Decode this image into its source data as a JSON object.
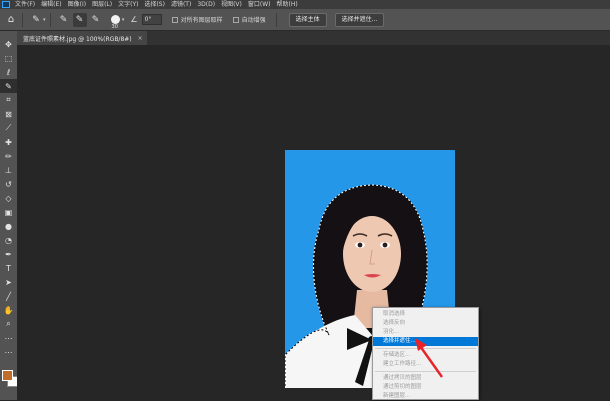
{
  "menubar": {
    "items": [
      "文件(F)",
      "编辑(E)",
      "图像(I)",
      "图层(L)",
      "文字(Y)",
      "选择(S)",
      "滤镜(T)",
      "3D(D)",
      "视图(V)",
      "窗口(W)",
      "帮助(H)"
    ]
  },
  "options": {
    "brush_size": "30",
    "angle": "0°",
    "sample_all_layers": "对所有图层取样",
    "auto_enhance": "自动增强",
    "select_subject": "选择主体",
    "select_and_mask": "选择并遮住..."
  },
  "document": {
    "tab_title": "蓝底证件照素材.jpg @ 100%(RGB/8#)",
    "close_glyph": "×"
  },
  "colors": {
    "foreground": "#c06c2b",
    "background": "#ffffff",
    "canvas_blue": "#2597e9",
    "menu_highlight": "#0078d7",
    "arrow_red": "#e8232a"
  },
  "context_menu": {
    "items": [
      {
        "label": "取消选择",
        "enabled": false
      },
      {
        "label": "选择反向",
        "enabled": false
      },
      {
        "label": "羽化...",
        "enabled": false
      },
      {
        "label": "选择并遮住...",
        "enabled": true,
        "highlighted": true
      },
      {
        "divider": true
      },
      {
        "label": "存储选区...",
        "enabled": false
      },
      {
        "label": "建立工作路径...",
        "enabled": false
      },
      {
        "divider": true
      },
      {
        "label": "通过拷贝的图层",
        "enabled": false
      },
      {
        "label": "通过剪切的图层",
        "enabled": false
      },
      {
        "label": "新建图层...",
        "enabled": false
      }
    ]
  },
  "toolbar": {
    "tools": [
      "move-tool",
      "marquee-tool",
      "lasso-tool",
      "quick-selection-tool",
      "crop-tool",
      "frame-tool",
      "eyedropper-tool",
      "healing-brush-tool",
      "brush-tool",
      "clone-stamp-tool",
      "history-brush-tool",
      "eraser-tool",
      "gradient-tool",
      "blur-tool",
      "dodge-tool",
      "pen-tool",
      "type-tool",
      "path-selection-tool",
      "shape-tool",
      "hand-tool",
      "zoom-tool",
      "more-tools"
    ],
    "active_index": 3
  }
}
